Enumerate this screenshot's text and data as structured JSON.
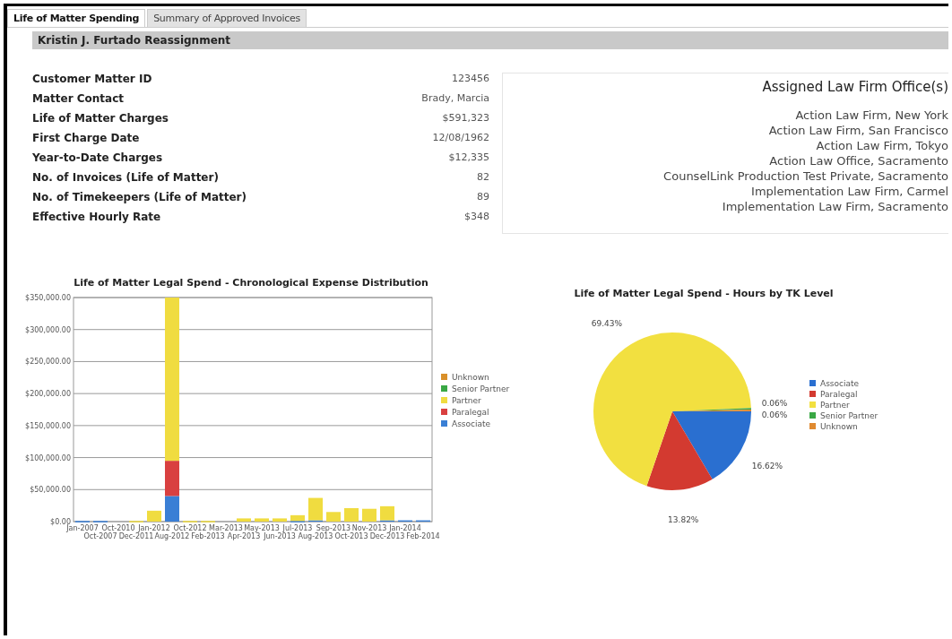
{
  "tabs": [
    {
      "label": "Life of Matter Spending",
      "selected": true
    },
    {
      "label": "Summary of Approved Invoices",
      "selected": false
    }
  ],
  "header": {
    "title": "Kristin J. Furtado Reassignment"
  },
  "details": [
    {
      "label": "Customer Matter ID",
      "value": "123456"
    },
    {
      "label": "Matter Contact",
      "value": "Brady, Marcia"
    },
    {
      "label": "Life of Matter Charges",
      "value": "$591,323"
    },
    {
      "label": "First Charge Date",
      "value": "12/08/1962"
    },
    {
      "label": "Year-to-Date Charges",
      "value": "$12,335"
    },
    {
      "label": "No. of Invoices (Life of Matter)",
      "value": "82"
    },
    {
      "label": "No. of Timekeepers (Life of Matter)",
      "value": "89"
    },
    {
      "label": "Effective Hourly Rate",
      "value": "$348"
    }
  ],
  "offices": {
    "title": "Assigned Law Firm Office(s)",
    "items": [
      "Action Law Firm, New York",
      "Action Law Firm, San Francisco",
      "Action Law Firm, Tokyo",
      "Action Law Office, Sacramento",
      "CounselLink Production Test Private, Sacramento",
      "Implementation Law Firm, Carmel",
      "Implementation Law Firm, Sacramento"
    ]
  },
  "spend_chart": {
    "chart_data": {
      "type": "bar",
      "stacked": true,
      "grid": true,
      "legend": true,
      "title": "Life of Matter Legal Spend - Chronological Expense Distribution",
      "categories": [
        "Jan-2007",
        "Oct-2007",
        "Oct-2010",
        "Dec-2011",
        "Jan-2012",
        "Aug-2012",
        "Oct-2012",
        "Feb-2013",
        "Mar-2013",
        "Apr-2013",
        "May-2013",
        "Jun-2013",
        "Jul-2013",
        "Aug-2013",
        "Sep-2013",
        "Oct-2013",
        "Nov-2013",
        "Dec-2013",
        "Jan-2014",
        "Feb-2014"
      ],
      "ylim": [
        0,
        350000
      ],
      "yticks": [
        {
          "value": 0,
          "label": "$0.00"
        },
        {
          "value": 50000,
          "label": "$50,000.00"
        },
        {
          "value": 100000,
          "label": "$100,000.00"
        },
        {
          "value": 150000,
          "label": "$150,000.00"
        },
        {
          "value": 200000,
          "label": "$200,000.00"
        },
        {
          "value": 250000,
          "label": "$250,000.00"
        },
        {
          "value": 300000,
          "label": "$300,000.00"
        },
        {
          "value": 350000,
          "label": "$350,000.00"
        }
      ],
      "series": [
        {
          "name": "Associate",
          "color": "#3a7fd5",
          "values": [
            1000,
            1000,
            0,
            0,
            0,
            40000,
            0,
            0,
            0,
            0,
            0,
            0,
            1000,
            2000,
            0,
            0,
            0,
            2000,
            2000,
            2000
          ]
        },
        {
          "name": "Paralegal",
          "color": "#d94040",
          "values": [
            0,
            0,
            0,
            0,
            0,
            55000,
            0,
            0,
            0,
            0,
            0,
            0,
            0,
            0,
            0,
            0,
            0,
            0,
            0,
            0
          ]
        },
        {
          "name": "Partner",
          "color": "#f0dc40",
          "values": [
            0,
            0,
            0,
            1000,
            17000,
            255000,
            1000,
            1000,
            0,
            5000,
            5000,
            5000,
            9000,
            35000,
            15000,
            21000,
            20000,
            22000,
            0,
            0
          ]
        },
        {
          "name": "Senior Partner",
          "color": "#3aa845",
          "values": [
            0,
            0,
            0,
            0,
            0,
            0,
            0,
            0,
            0,
            0,
            0,
            0,
            0,
            0,
            0,
            0,
            0,
            0,
            0,
            0
          ]
        },
        {
          "name": "Unknown",
          "color": "#d9902a",
          "values": [
            0,
            0,
            0,
            0,
            0,
            0,
            0,
            0,
            0,
            0,
            0,
            0,
            0,
            0,
            0,
            0,
            0,
            0,
            0,
            0
          ]
        }
      ]
    }
  },
  "hours_chart": {
    "chart_data": {
      "type": "pie",
      "legend": true,
      "title": "Life of Matter Legal Spend - Hours by TK Level",
      "categories": [
        "Associate",
        "Paralegal",
        "Partner",
        "Senior Partner",
        "Unknown"
      ],
      "values": [
        16.62,
        13.82,
        69.43,
        0.06,
        0.06
      ],
      "colors": [
        "#2a6fd0",
        "#d33a30",
        "#f2e040",
        "#3aa845",
        "#e08a30"
      ],
      "value_labels": [
        "16.62%",
        "13.82%",
        "69.43%",
        "0.06%",
        "0.06%"
      ]
    }
  }
}
